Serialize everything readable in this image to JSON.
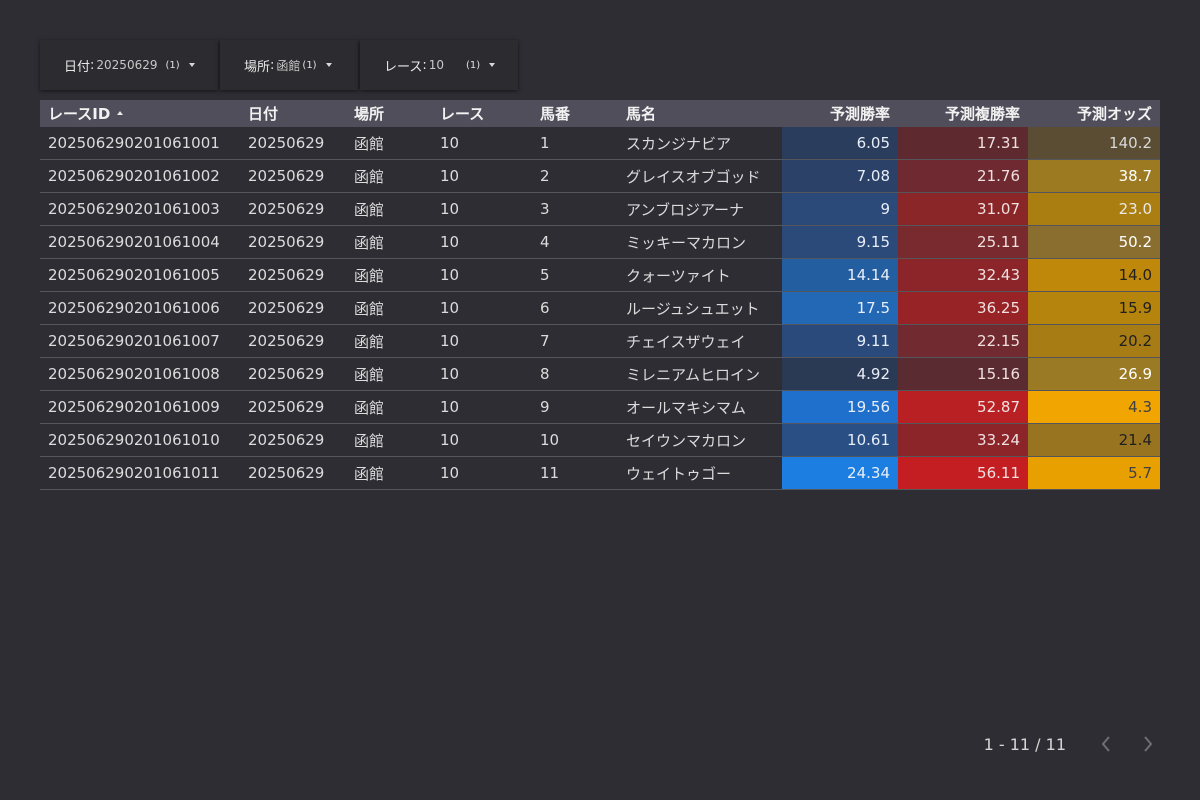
{
  "filters": [
    {
      "label": "日付",
      "value": "20250629",
      "count": "(1)"
    },
    {
      "label": "場所",
      "value": "函館",
      "count": "(1)"
    },
    {
      "label": "レース",
      "value": "10",
      "count": "(1)"
    }
  ],
  "table": {
    "headers": [
      "レースID",
      "日付",
      "場所",
      "レース",
      "馬番",
      "馬名",
      "予測勝率",
      "予測複勝率",
      "予測オッズ"
    ],
    "sort_column": "レースID",
    "sort_direction": "ascending",
    "rows": [
      [
        "202506290201061001",
        "20250629",
        "函館",
        "10",
        "1",
        "スカンジナビア",
        "6.05",
        "17.31",
        "140.2"
      ],
      [
        "202506290201061002",
        "20250629",
        "函館",
        "10",
        "2",
        "グレイスオブゴッド",
        "7.08",
        "21.76",
        "38.7"
      ],
      [
        "202506290201061003",
        "20250629",
        "函館",
        "10",
        "3",
        "アンブロジアーナ",
        "9",
        "31.07",
        "23.0"
      ],
      [
        "202506290201061004",
        "20250629",
        "函館",
        "10",
        "4",
        "ミッキーマカロン",
        "9.15",
        "25.11",
        "50.2"
      ],
      [
        "202506290201061005",
        "20250629",
        "函館",
        "10",
        "5",
        "クォーツァイト",
        "14.14",
        "32.43",
        "14.0"
      ],
      [
        "202506290201061006",
        "20250629",
        "函館",
        "10",
        "6",
        "ルージュシュエット",
        "17.5",
        "36.25",
        "15.9"
      ],
      [
        "202506290201061007",
        "20250629",
        "函館",
        "10",
        "7",
        "チェイスザウェイ",
        "9.11",
        "22.15",
        "20.2"
      ],
      [
        "202506290201061008",
        "20250629",
        "函館",
        "10",
        "8",
        "ミレニアムヒロイン",
        "4.92",
        "15.16",
        "26.9"
      ],
      [
        "202506290201061009",
        "20250629",
        "函館",
        "10",
        "9",
        "オールマキシマム",
        "19.56",
        "52.87",
        "4.3"
      ],
      [
        "202506290201061010",
        "20250629",
        "函館",
        "10",
        "10",
        "セイウンマカロン",
        "10.61",
        "33.24",
        "21.4"
      ],
      [
        "202506290201061011",
        "20250629",
        "函館",
        "10",
        "11",
        "ウェイトゥゴー",
        "24.34",
        "56.11",
        "5.7"
      ]
    ],
    "heat_colors": {
      "win_rate": [
        "#2a3d5c",
        "#2b4168",
        "#2b4a7a",
        "#2b4a7a",
        "#235ea0",
        "#2368b5",
        "#2a4a7c",
        "#2a3a55",
        "#1f6fcc",
        "#2a4f85",
        "#1c7ee0"
      ],
      "place_rate": [
        "#5e2a30",
        "#6e2a30",
        "#8a2528",
        "#792a2e",
        "#8b2529",
        "#972326",
        "#702a30",
        "#5a2b31",
        "#b82024",
        "#8c2529",
        "#c41e22"
      ],
      "odds": [
        "#5a4d33",
        "#9c7a22",
        "#aa7e10",
        "#8a6e30",
        "#c0880a",
        "#b5840c",
        "#a77c14",
        "#9a7a24",
        "#f0a500",
        "#997420",
        "#e8a000"
      ]
    },
    "odds_text_colors": [
      "#d8d8d8",
      "#ffffff",
      "#e8e8e8",
      "#ffffff",
      "#202020",
      "#202020",
      "#202020",
      "#ffffff",
      "#404040",
      "#202020",
      "#404040"
    ]
  },
  "pagination": {
    "range": "1 - 11 / 11"
  }
}
